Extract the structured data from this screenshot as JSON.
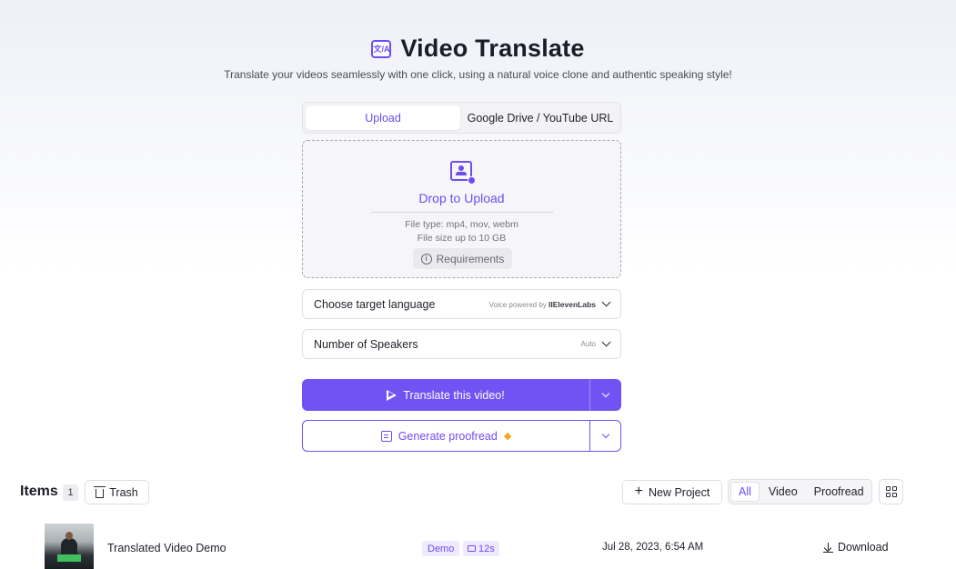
{
  "header": {
    "title": "Video Translate",
    "title_icon": "文/A",
    "subtitle": "Translate your videos seamlessly with one click, using a natural voice clone and authentic speaking style!"
  },
  "source_tabs": [
    {
      "label": "Upload",
      "active": true
    },
    {
      "label": "Google Drive / YouTube URL",
      "active": false
    }
  ],
  "dropzone": {
    "icon": "upload-person-icon",
    "title": "Drop to Upload",
    "file_types": "File type: mp4, mov, webm",
    "file_size": "File size up to 10 GB",
    "requirements_label": "Requirements"
  },
  "language_select": {
    "label": "Choose target language",
    "powered_prefix": "Voice powered by",
    "powered_brand": "IIElevenLabs"
  },
  "speakers_select": {
    "label": "Number of Speakers",
    "value": "Auto"
  },
  "translate_button": {
    "label": "Translate this video!"
  },
  "proofread_button": {
    "label": "Generate proofread"
  },
  "items": {
    "title": "Items",
    "count": "1",
    "trash_label": "Trash",
    "new_project_label": "New Project",
    "filters": [
      {
        "label": "All",
        "active": true
      },
      {
        "label": "Video",
        "active": false
      },
      {
        "label": "Proofread",
        "active": false
      }
    ],
    "rows": [
      {
        "name": "Translated Video Demo",
        "tag": "Demo",
        "duration": "12s",
        "date": "Jul 28, 2023, 6:54 AM",
        "action": "Download"
      }
    ]
  },
  "colors": {
    "accent": "#7152f3",
    "accent_text": "#6d4cf5",
    "tag_bg": "#efeafd"
  }
}
